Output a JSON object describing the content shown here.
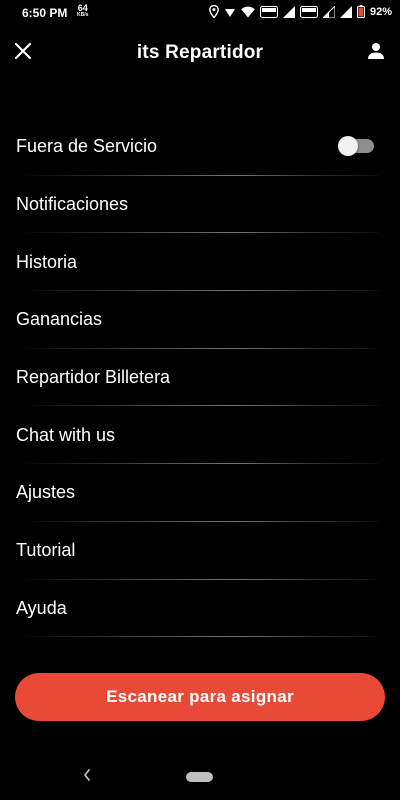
{
  "status_bar": {
    "time": "6:50 PM",
    "speed_value": "64",
    "speed_unit": "KB/s",
    "battery_percent": "92%"
  },
  "header": {
    "title": "its Repartidor",
    "close_icon": "close-icon",
    "profile_icon": "person-icon"
  },
  "menu": {
    "items": [
      {
        "label": "Fuera de Servicio",
        "has_toggle": true,
        "toggle_on": false
      },
      {
        "label": "Notificaciones"
      },
      {
        "label": "Historia"
      },
      {
        "label": "Ganancias"
      },
      {
        "label": "Repartidor Billetera"
      },
      {
        "label": "Chat with us"
      },
      {
        "label": "Ajustes"
      },
      {
        "label": "Tutorial"
      },
      {
        "label": "Ayuda"
      }
    ]
  },
  "scan_button": {
    "label": "Escanear para asignar"
  },
  "colors": {
    "background": "#000000",
    "accent": "#e94a37",
    "text": "#ffffff"
  }
}
